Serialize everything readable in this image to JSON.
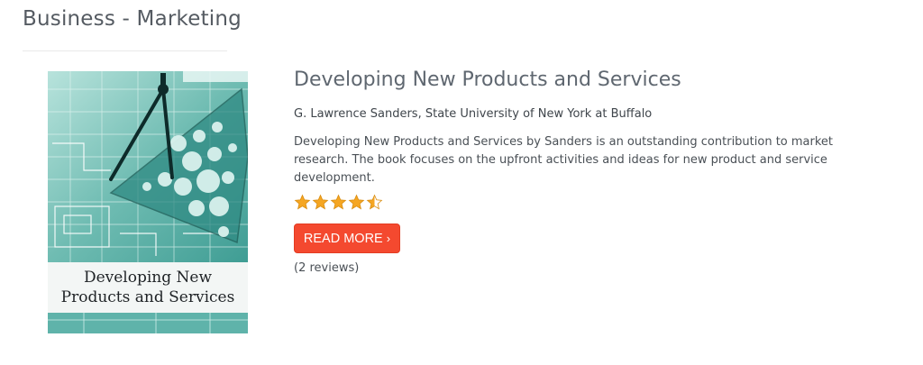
{
  "category": {
    "title": "Business - Marketing"
  },
  "book": {
    "cover": {
      "line1": "Developing New",
      "line2": "Products and Services"
    },
    "title": "Developing New Products and Services",
    "author": "G. Lawrence Sanders, State University of New York at Buffalo",
    "description": "Developing New Products and Services by Sanders is an outstanding contribution to market research. The book focuses on the upfront activities and ideas for new product and service development.",
    "rating": {
      "value": 4.5,
      "max": 5,
      "star_color": "#f5a623",
      "empty_color": "#ffffff"
    },
    "read_more": {
      "label": "READ MORE",
      "chevron": "›",
      "color": "#f4492f"
    },
    "reviews": "(2 reviews)"
  }
}
